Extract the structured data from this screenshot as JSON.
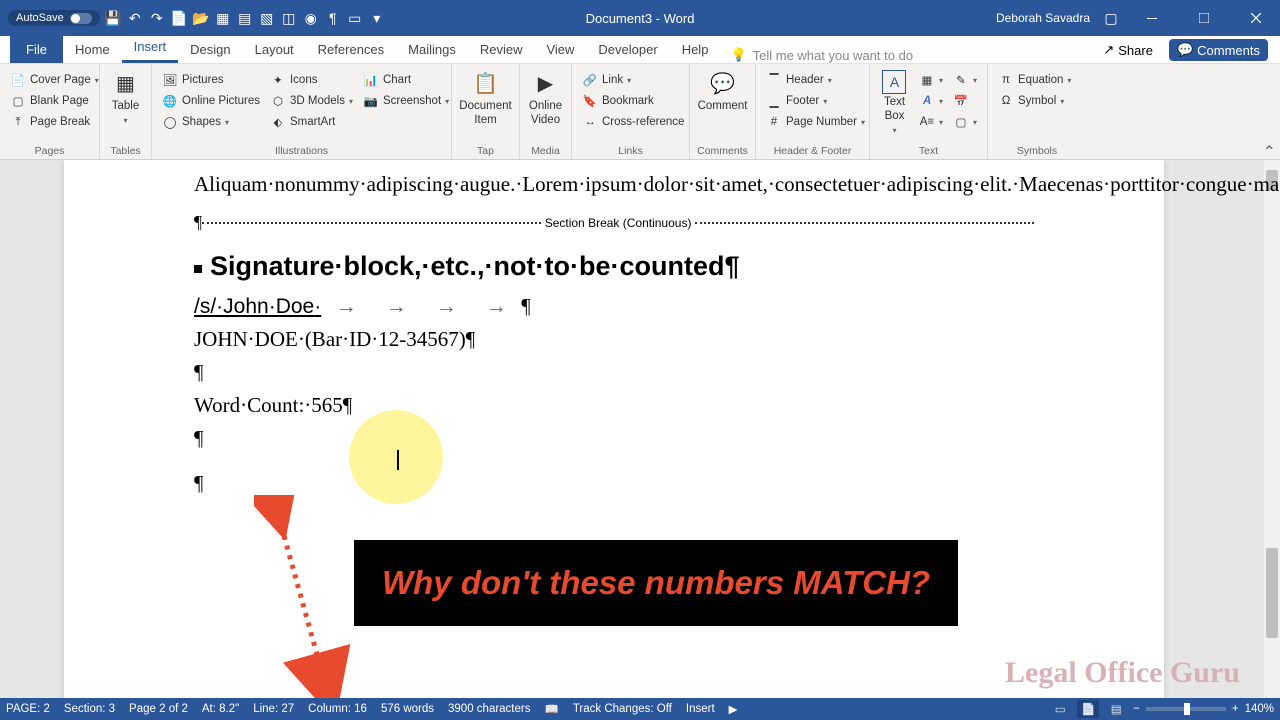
{
  "titlebar": {
    "autosave_label": "AutoSave",
    "doc_title": "Document3 - Word",
    "user": "Deborah Savadra"
  },
  "tabs": {
    "file": "File",
    "list": [
      "Home",
      "Insert",
      "Design",
      "Layout",
      "References",
      "Mailings",
      "Review",
      "View",
      "Developer",
      "Help"
    ],
    "active_index": 1,
    "tellme_placeholder": "Tell me what you want to do",
    "share": "Share",
    "comments": "Comments"
  },
  "ribbon": {
    "pages": {
      "label": "Pages",
      "cover": "Cover Page",
      "blank": "Blank Page",
      "break": "Page Break"
    },
    "tables": {
      "label": "Tables",
      "table": "Table"
    },
    "illustrations": {
      "label": "Illustrations",
      "pictures": "Pictures",
      "online_pictures": "Online Pictures",
      "shapes": "Shapes",
      "icons": "Icons",
      "models": "3D Models",
      "smartart": "SmartArt",
      "chart": "Chart",
      "screenshot": "Screenshot"
    },
    "tap": {
      "label": "Tap",
      "document_item": "Document Item"
    },
    "media": {
      "label": "Media",
      "online_video": "Online Video"
    },
    "links": {
      "label": "Links",
      "link": "Link",
      "bookmark": "Bookmark",
      "crossref": "Cross-reference"
    },
    "comments": {
      "label": "Comments",
      "comment": "Comment"
    },
    "headerfooter": {
      "label": "Header & Footer",
      "header": "Header",
      "footer": "Footer",
      "pagenum": "Page Number"
    },
    "text": {
      "label": "Text",
      "textbox": "Text Box"
    },
    "symbols": {
      "label": "Symbols",
      "equation": "Equation",
      "symbol": "Symbol"
    }
  },
  "document": {
    "para1": "Aliquam·nonummy·adipiscing·augue.·Lorem·ipsum·dolor·sit·amet,·consectetuer·adipiscing·elit.·Maecenas·porttitor·congue·massa.·Fusce·posuere,·magna·sed·pulvinar·ultricies,·purus·lectus·malesuada·libero,·sit·amet·commodo·magna·eros·quis·urna.·Nunc·viverra·imperdiet·enim.¶",
    "section_break": "Section Break (Continuous)",
    "heading": "Signature·block,·etc.,·not·to·be·counted¶",
    "sig_line": "/s/·John·Doe",
    "sig_name": "JOHN·DOE·(Bar·ID·12-34567)¶",
    "word_count_line": "Word·Count:·565¶"
  },
  "callout": "Why don't these numbers MATCH?",
  "watermark": "Legal Office Guru",
  "statusbar": {
    "page": "PAGE: 2",
    "section": "Section: 3",
    "page_of": "Page 2 of 2",
    "at": "At: 8.2\"",
    "line": "Line: 27",
    "column": "Column: 16",
    "words": "576 words",
    "chars": "3900 characters",
    "track": "Track Changes: Off",
    "insert": "Insert",
    "zoom": "140%"
  }
}
